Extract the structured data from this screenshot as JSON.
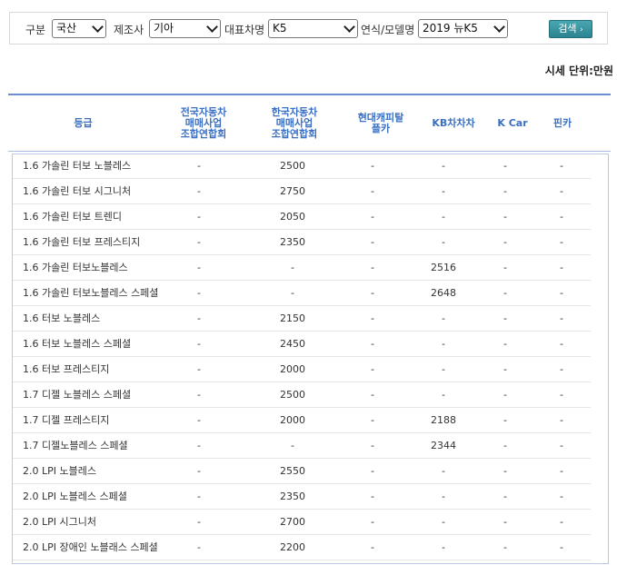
{
  "filters": {
    "category_label": "구분",
    "category_value": "국산",
    "maker_label": "제조사",
    "maker_value": "기아",
    "model_label": "대표차명",
    "model_value": "K5",
    "year_label": "연식/모델명",
    "year_value": "2019 뉴K5",
    "search_label": "검색"
  },
  "unit_text": "시세 단위:만원",
  "table": {
    "headers": [
      "등급",
      "전국자동차\n매매사업\n조합연합회",
      "한국자동차\n매매사업\n조합연합회",
      "현대캐피탈\n플카",
      "KB차차차",
      "K Car",
      "핀카"
    ],
    "rows": [
      [
        "1.6 가솔린 터보 노블레스",
        "-",
        "2500",
        "-",
        "-",
        "-",
        "-"
      ],
      [
        "1.6 가솔린 터보 시그니처",
        "-",
        "2750",
        "-",
        "-",
        "-",
        "-"
      ],
      [
        "1.6 가솔린 터보 트렌디",
        "-",
        "2050",
        "-",
        "-",
        "-",
        "-"
      ],
      [
        "1.6 가솔린 터보 프레스티지",
        "-",
        "2350",
        "-",
        "-",
        "-",
        "-"
      ],
      [
        "1.6 가솔린 터보노블레스",
        "-",
        "-",
        "-",
        "2516",
        "-",
        "-"
      ],
      [
        "1.6 가솔린 터보노블레스 스페셜",
        "-",
        "-",
        "-",
        "2648",
        "-",
        "-"
      ],
      [
        "1.6 터보 노블레스",
        "-",
        "2150",
        "-",
        "-",
        "-",
        "-"
      ],
      [
        "1.6 터보 노블레스 스페셜",
        "-",
        "2450",
        "-",
        "-",
        "-",
        "-"
      ],
      [
        "1.6 터보 프레스티지",
        "-",
        "2000",
        "-",
        "-",
        "-",
        "-"
      ],
      [
        "1.7 디젤 노블레스 스페셜",
        "-",
        "2500",
        "-",
        "-",
        "-",
        "-"
      ],
      [
        "1.7 디젤 프레스티지",
        "-",
        "2000",
        "-",
        "2188",
        "-",
        "-"
      ],
      [
        "1.7 디젤노블레스 스페셜",
        "-",
        "-",
        "-",
        "2344",
        "-",
        "-"
      ],
      [
        "2.0 LPI 노블레스",
        "-",
        "2550",
        "-",
        "-",
        "-",
        "-"
      ],
      [
        "2.0 LPI 노블레스 스페셜",
        "-",
        "2350",
        "-",
        "-",
        "-",
        "-"
      ],
      [
        "2.0 LPI 시그니처",
        "-",
        "2700",
        "-",
        "-",
        "-",
        "-"
      ],
      [
        "2.0 LPI 장애인 노블래스 스페셜",
        "-",
        "2200",
        "-",
        "-",
        "-",
        "-"
      ]
    ]
  }
}
